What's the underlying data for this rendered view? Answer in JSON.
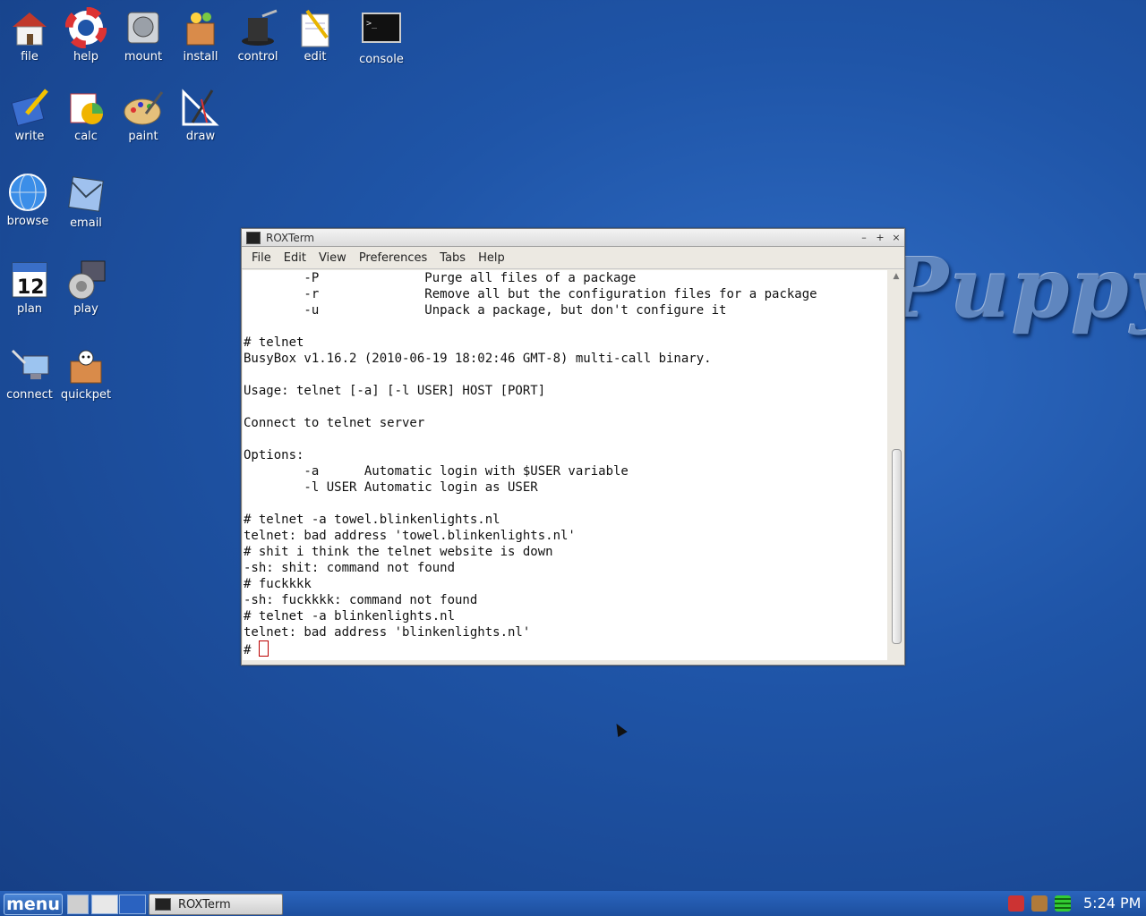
{
  "desktop": {
    "logo_text": "Puppy",
    "icons": [
      {
        "label": "file"
      },
      {
        "label": "help"
      },
      {
        "label": "mount"
      },
      {
        "label": "install"
      },
      {
        "label": "control"
      },
      {
        "label": "edit"
      },
      {
        "label": "console"
      },
      {
        "label": "write"
      },
      {
        "label": "calc"
      },
      {
        "label": "paint"
      },
      {
        "label": "draw"
      },
      {
        "label": "browse"
      },
      {
        "label": "email"
      },
      {
        "label": "plan",
        "badge": "12"
      },
      {
        "label": "play"
      },
      {
        "label": "connect"
      },
      {
        "label": "quickpet"
      }
    ]
  },
  "window": {
    "title": "ROXTerm",
    "controls": {
      "minimize": "–",
      "maximize": "+",
      "close": "×"
    },
    "menu": [
      "File",
      "Edit",
      "View",
      "Preferences",
      "Tabs",
      "Help"
    ],
    "terminal_lines": [
      "        -P              Purge all files of a package",
      "        -r              Remove all but the configuration files for a package",
      "        -u              Unpack a package, but don't configure it",
      "",
      "# telnet",
      "BusyBox v1.16.2 (2010-06-19 18:02:46 GMT-8) multi-call binary.",
      "",
      "Usage: telnet [-a] [-l USER] HOST [PORT]",
      "",
      "Connect to telnet server",
      "",
      "Options:",
      "        -a      Automatic login with $USER variable",
      "        -l USER Automatic login as USER",
      "",
      "# telnet -a towel.blinkenlights.nl",
      "telnet: bad address 'towel.blinkenlights.nl'",
      "# shit i think the telnet website is down",
      "-sh: shit: command not found",
      "# fuckkkk",
      "-sh: fuckkkk: command not found",
      "# telnet -a blinkenlights.nl",
      "telnet: bad address 'blinkenlights.nl'"
    ],
    "prompt": "# ",
    "scroll_position": 0.95
  },
  "taskbar": {
    "menu_label": "menu",
    "task_label": "ROXTerm",
    "clock": "5:24 PM"
  }
}
